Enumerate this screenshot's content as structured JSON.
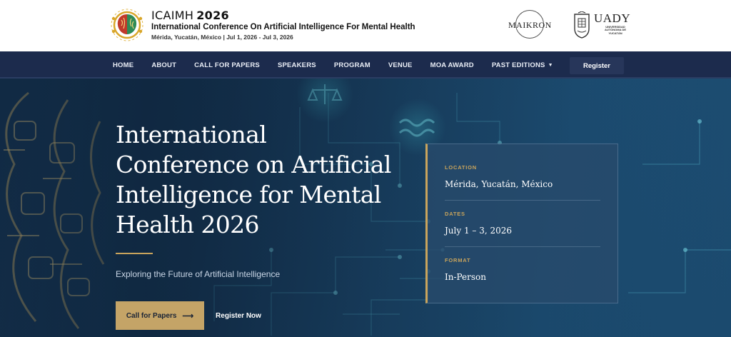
{
  "header": {
    "brand_short": "ICAIMH",
    "brand_year": "2026",
    "brand_full": "International Conference On Artificial Intelligence For Mental Health",
    "brand_meta": "Mérida, Yucatán, México | Jul 1, 2026 - Jul 3, 2026",
    "partner_maikron": "MAIKRON",
    "partner_uady": "UADY",
    "partner_uady_sub": "UNIVERSIDAD AUTÓNOMA DE YUCATÁN"
  },
  "nav": {
    "items": [
      {
        "label": "HOME"
      },
      {
        "label": "ABOUT"
      },
      {
        "label": "CALL FOR PAPERS"
      },
      {
        "label": "SPEAKERS"
      },
      {
        "label": "PROGRAM"
      },
      {
        "label": "VENUE"
      },
      {
        "label": "MOA AWARD"
      },
      {
        "label": "PAST EDITIONS"
      }
    ],
    "register_label": "Register"
  },
  "hero": {
    "title": "International Conference on Artificial Intelligence for Mental Health 2026",
    "tagline": "Exploring the Future of Artificial Intelligence",
    "cta_primary": "Call for Papers",
    "cta_primary_icon": "arrow-right-icon",
    "cta_secondary": "Register Now"
  },
  "info_card": {
    "location_label": "LOCATION",
    "location_value": "Mérida, Yucatán, México",
    "dates_label": "DATES",
    "dates_value": "July 1 – 3, 2026",
    "format_label": "FORMAT",
    "format_value": "In-Person"
  },
  "colors": {
    "nav_bg": "#1c2b4d",
    "accent_gold": "#c9a45c",
    "hero_bg": "#1d4b70"
  }
}
